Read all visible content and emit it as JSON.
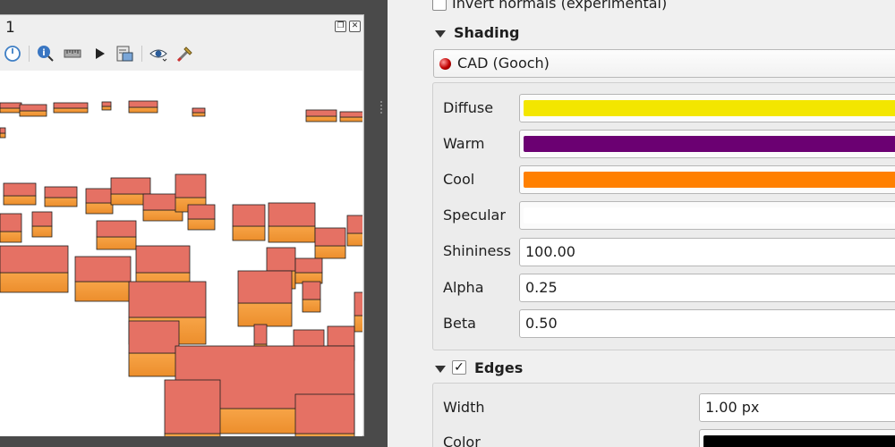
{
  "view_panel": {
    "title": "1",
    "float_icon": "float-window-icon",
    "close_icon": "close-icon"
  },
  "toolbar": {
    "icons": [
      "camera-reset-icon",
      "identify-icon",
      "measure-line-icon",
      "play-animation-icon",
      "export-scene-icon",
      "view-options-icon",
      "configure-icon"
    ]
  },
  "settings": {
    "invert_normals": {
      "label": "Invert normals (experimental)",
      "checked": false
    },
    "shading": {
      "title": "Shading",
      "technique": "CAD (Gooch)",
      "rows": {
        "diffuse": {
          "label": "Diffuse",
          "color": "#f3e600"
        },
        "warm": {
          "label": "Warm",
          "color": "#6b0072"
        },
        "cool": {
          "label": "Cool",
          "color": "#ff8000"
        },
        "specular": {
          "label": "Specular",
          "color": "#ffffff"
        },
        "shininess": {
          "label": "Shininess",
          "value": "100.00"
        },
        "alpha": {
          "label": "Alpha",
          "value": "0.25"
        },
        "beta": {
          "label": "Beta",
          "value": "0.50"
        }
      }
    },
    "edges": {
      "title": "Edges",
      "checked": true,
      "check_glyph": "✓",
      "width": {
        "label": "Width",
        "value": "1.00 px"
      },
      "color": {
        "label": "Color",
        "color": "#000000"
      }
    }
  },
  "colors": {
    "building_top": "#e57164",
    "building_side": "#f39a3a",
    "building_side_dark": "#e08a2c"
  }
}
